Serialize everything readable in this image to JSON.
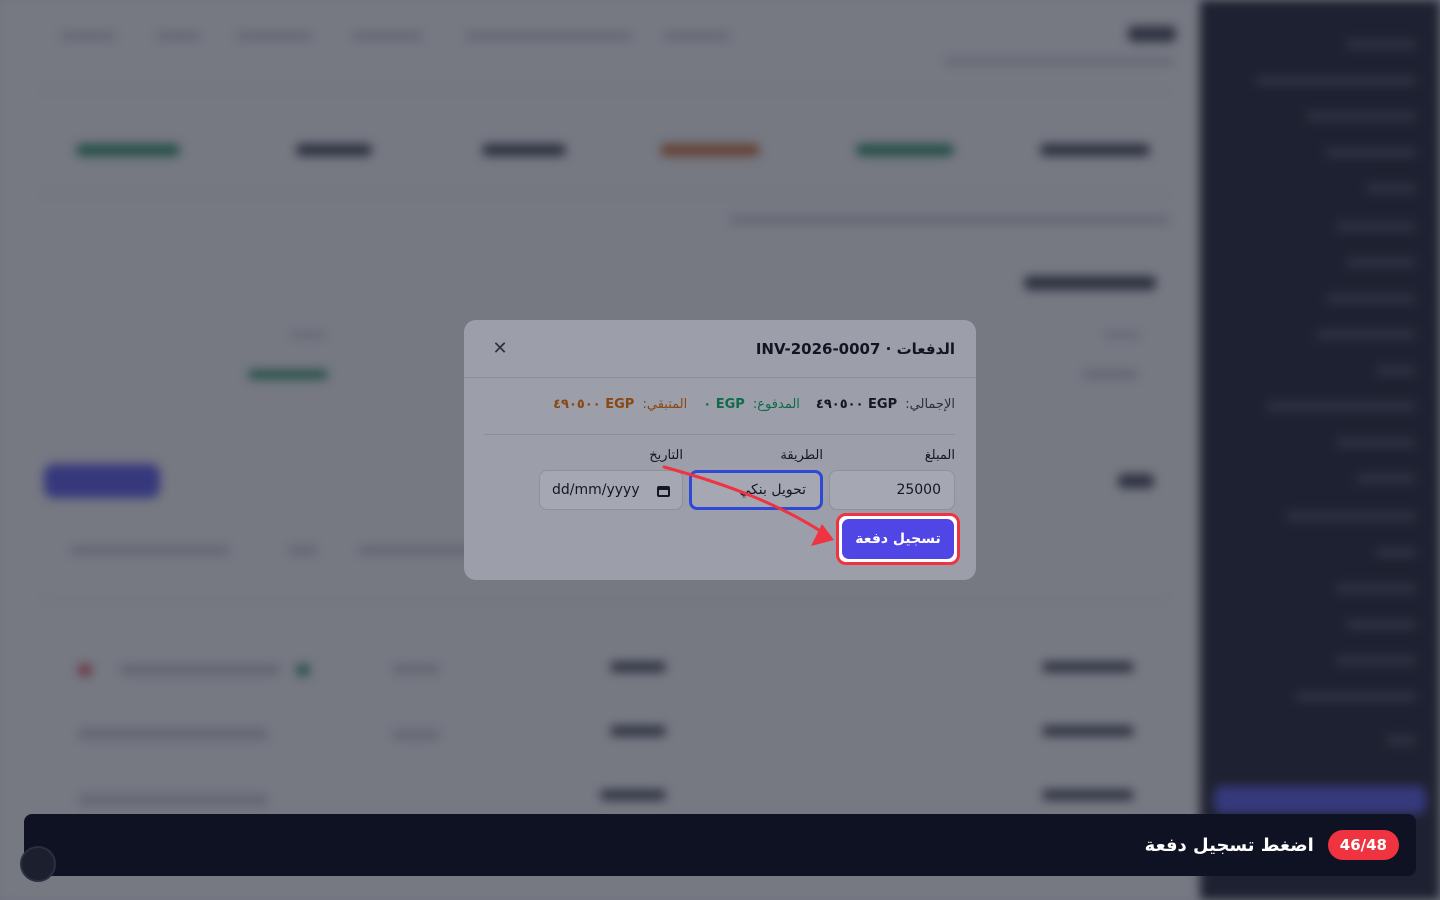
{
  "modal": {
    "title": "الدفعات · INV-2026-0007",
    "close_icon": "close-icon",
    "totals": {
      "total_label": "الإجمالي:",
      "total_value": "EGP ٤٩٠٥٠٠",
      "paid_label": "المدفوع:",
      "paid_value": "EGP ٠",
      "remaining_label": "المتبقي:",
      "remaining_value": "EGP ٤٩٠٥٠٠"
    },
    "form": {
      "amount_label": "المبلغ",
      "amount_value": "25000",
      "method_label": "الطريقة",
      "method_value": "تحويل بنكي",
      "date_label": "التاريخ",
      "date_placeholder": "dd/mm/yyyy",
      "date_icon": "calendar-icon"
    },
    "submit_label": "تسجيل دفعة"
  },
  "tour": {
    "step": "46/48",
    "instruction": "اضغط تسجيل دفعة"
  },
  "colors": {
    "primary": "#4f46e5",
    "highlight": "#ef3340",
    "paid": "#0f6b49",
    "remaining": "#8a4713",
    "sidebar": "#0f1222"
  }
}
